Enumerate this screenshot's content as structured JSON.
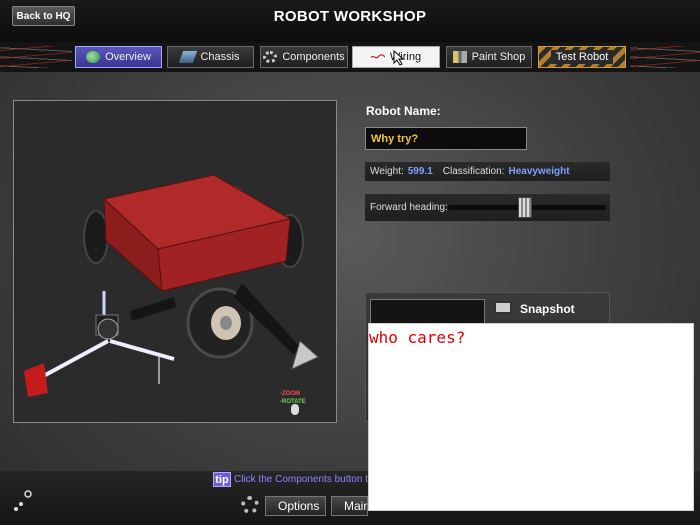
{
  "header": {
    "back_label": "Back to HQ",
    "title": "ROBOT WORKSHOP"
  },
  "nav": {
    "tabs": [
      {
        "label": "Overview",
        "icon": "globe-icon",
        "active": true
      },
      {
        "label": "Chassis",
        "icon": "chassis-icon"
      },
      {
        "label": "Components",
        "icon": "gear-icon"
      },
      {
        "label": "Wiring",
        "icon": "wire-icon"
      },
      {
        "label": "Paint Shop",
        "icon": "paint-icon"
      },
      {
        "label": "Test Robot",
        "icon": "hazard-stripes"
      }
    ]
  },
  "viewport": {
    "zoom_hint": "ZOOM",
    "rotate_hint": "ROTATE"
  },
  "robot": {
    "name_label": "Robot Name:",
    "name_value": "Why try?",
    "weight_label": "Weight:",
    "weight_value": "599.1",
    "class_label": "Classification:",
    "class_value": "Heavyweight",
    "heading_label": "Forward heading:",
    "heading_level": 0.5,
    "snapshot_label": "Snapshot"
  },
  "overlay": {
    "text": "who cares?"
  },
  "footer": {
    "tip_badge": "tip",
    "tip_text": "Click the Components button to c",
    "options_label": "Options",
    "main_label": "Main M"
  },
  "colors": {
    "accent": "#5b57b8",
    "name_text": "#f3c33a",
    "stat_value": "#7fa0ff",
    "overlay_text": "#e00000"
  }
}
